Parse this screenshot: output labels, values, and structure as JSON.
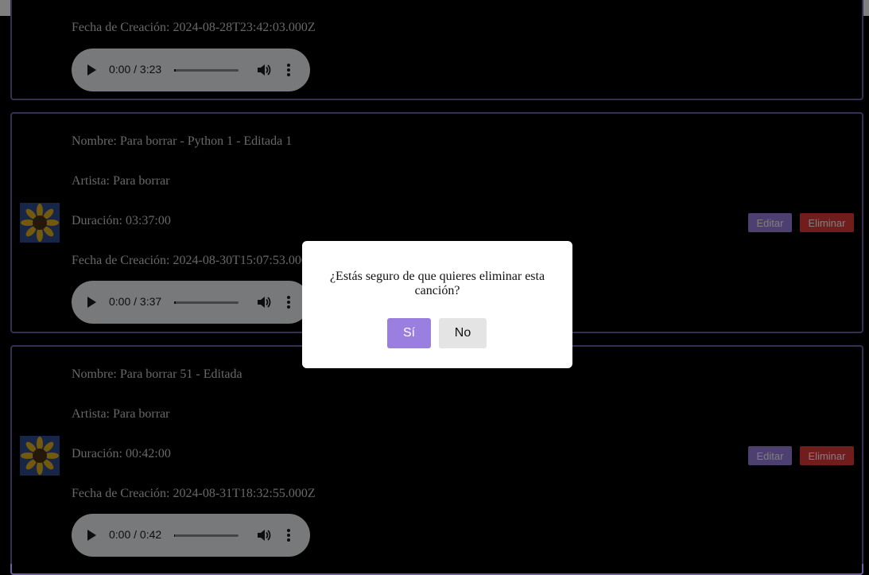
{
  "songs": [
    {
      "nombre": "",
      "artista": "",
      "duracion": "",
      "fecha": "Fecha de Creación: 2024-08-28T23:42:03.000Z",
      "player_time": "0:00 / 3:23",
      "progress": 0
    },
    {
      "nombre": "Nombre: Para borrar - Python 1 - Editada 1",
      "artista": "Artista: Para borrar",
      "duracion": "Duración: 03:37:00",
      "fecha": "Fecha de Creación: 2024-08-30T15:07:53.000Z",
      "player_time": "0:00 / 3:37",
      "progress": 0
    },
    {
      "nombre": "Nombre: Para borrar 51 - Editada",
      "artista": "Artista: Para borrar",
      "duracion": "Duración: 00:42:00",
      "fecha": "Fecha de Creación: 2024-08-31T18:32:55.000Z",
      "player_time": "0:00 / 0:42",
      "progress": 0
    }
  ],
  "actions": {
    "edit_label": "Editar",
    "delete_label": "Eliminar"
  },
  "dialog": {
    "message": "¿Estás seguro de que quieres eliminar esta canción?",
    "yes_label": "Sí",
    "no_label": "No"
  },
  "colors": {
    "accent": "#9b7fe0",
    "danger": "#e23a3a",
    "card_border": "#6f5da8"
  },
  "icons": {
    "thumbnail": "sunflower-image",
    "play": "play-icon",
    "volume": "volume-icon",
    "more": "more-vert-icon"
  }
}
